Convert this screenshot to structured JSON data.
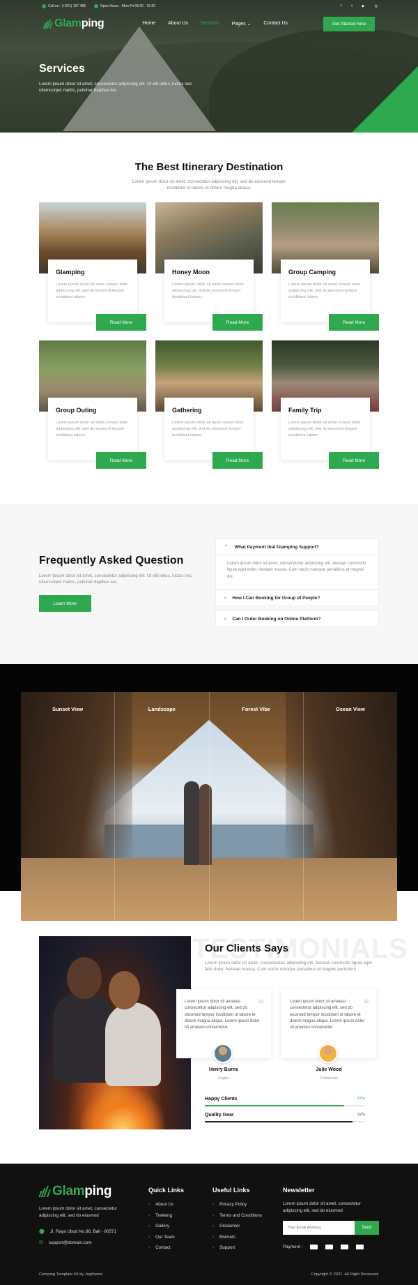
{
  "topbar": {
    "call": "Call on : (+021) 157 488",
    "hours": "Open Hours : Mon-Fri 08.00 - 15.00",
    "socials": [
      "facebook-icon",
      "twitter-icon",
      "youtube-icon",
      "instagram-icon"
    ]
  },
  "brand": {
    "name_part1": "Glam",
    "name_part2": "ping"
  },
  "nav": {
    "items": [
      "Home",
      "About Us",
      "Services",
      "Pages",
      "Contact Us"
    ],
    "active": "Services",
    "cta": "Get Started Now"
  },
  "hero": {
    "title": "Services",
    "subtitle": "Lorem ipsum dolor sit amet, consectetur adipiscing elit. Ut elit tellus, luctus nec ullamcorper mattis, pulvinar dapibus leo."
  },
  "itinerary": {
    "title": "The Best Itinerary Destination",
    "subtitle": "Lorem ipsum dolor sit amet, consectetur adipiscing elit, sed do eiusmod tempor incididunt ut labore et dolore magna aliqua.",
    "cards": [
      {
        "title": "Glamping",
        "text": "Lorem ipsum dolor sit amet consec tetur adipiscing elit, sed do eiusmod tempor incididunt labore.",
        "button": "Read More"
      },
      {
        "title": "Honey Moon",
        "text": "Lorem ipsum dolor sit amet consec tetur adipiscing elit, sed do eiusmod tempor incididunt labore.",
        "button": "Read More"
      },
      {
        "title": "Group Camping",
        "text": "Lorem ipsum dolor sit amet consec tetur adipiscing elit, sed do eiusmod tempor incididunt labore.",
        "button": "Read More"
      },
      {
        "title": "Group Outing",
        "text": "Lorem ipsum dolor sit amet consec tetur adipiscing elit, sed do eiusmod tempor incididunt labore.",
        "button": "Read More"
      },
      {
        "title": "Gathering",
        "text": "Lorem ipsum dolor sit amet consec tetur adipiscing elit, sed do eiusmod tempor incididunt labore.",
        "button": "Read More"
      },
      {
        "title": "Family Trip",
        "text": "Lorem ipsum dolor sit amet consec tetur adipiscing elit, sed do eiusmod tempor incididunt labore.",
        "button": "Read More"
      }
    ]
  },
  "faq": {
    "title": "Frequently Asked Question",
    "desc": "Lorem ipsum dolor sit amet, consectetur adipiscing elit. Ut elit tellus, luctus nec ullamcorper mattis, pulvinar dapibus leo.",
    "button": "Learn More",
    "items": [
      {
        "question": "What Payment that Glamping Support?",
        "answer": "Lorem ipsum dolor sit amet, consectetuer adipiscing elit. Aenean commodo ligula eget dolor. Aenean massa. Cum sociis natoque penatibus et magnis dis."
      },
      {
        "question": "How I Can Booking for Group of People?"
      },
      {
        "question": "Can I Order Booking on Online Platform?"
      }
    ]
  },
  "gallery": {
    "tabs": [
      "Sunset View",
      "Landscape",
      "Forest Vibe",
      "Ocean View"
    ]
  },
  "testimonials": {
    "watermark": "TESTIMONIALS",
    "title": "Our Clients Says",
    "desc": "Lorem ipsum dolor sit amet, consectetuer adipiscing elit. Aenean commodo ligula eget  felis dolor. Aenean massa. Cum sociis natoque penatibus et magnis parturient.",
    "reviews": [
      {
        "text": "Lorem ipsum dolor sit ametasi consectetur adipiscing elit, sed do eiusmod tempor incididunt ut labore et dolore magna aliqua. Lorem ipsum dolor sit ametasi consectetur.",
        "name": "Henry Burns",
        "role": "Angler"
      },
      {
        "text": "Lorem ipsum dolor sit ametasi consectetur adipiscing elit, sed do eiusmod tempor incididunt ut labore et dolore magna aliqua. Lorem ipsum dolor sit ametasi consectetur.",
        "name": "Julie Wood",
        "role": "Fisherman"
      }
    ],
    "skills": [
      {
        "label": "Happy Clients",
        "percent": "87%",
        "value": 87,
        "color": "#2ea94f"
      },
      {
        "label": "Quality Gear",
        "percent": "92%",
        "value": 92,
        "color": "#222222"
      }
    ]
  },
  "footer": {
    "about": "Lorem ipsum dolor sit amet, consectetur adipiscing elit, sed do eiusmod",
    "address": "Jl. Raya Ubud No.88, Bali - 80571",
    "email": "support@domain.com",
    "quick_links_title": "Quick Links",
    "quick_links": [
      "About Us",
      "Trekking",
      "Gallery",
      "Our Team",
      "Contact"
    ],
    "useful_links_title": "Useful Links",
    "useful_links": [
      "Privacy Policy",
      "Terms and Conditions",
      "Disclaimer",
      "Elemets",
      "Support"
    ],
    "newsletter_title": "Newsletter",
    "newsletter_desc": "Lorem ipsum dolor sit amet, consectetur adipiscing elit, sed do eiusmod",
    "email_placeholder": "Your Email Address",
    "send": "Send",
    "payment_label": "Payment :",
    "payment_icons": [
      "visa-icon",
      "mastercard-icon",
      "paypal-icon",
      "card-icon"
    ],
    "credit": "Camping Template Kit by Jegtheme",
    "copyright": "Copyright © 2021. All Right Reserved."
  },
  "colors": {
    "accent": "#2ea94f",
    "dark": "#111111"
  }
}
